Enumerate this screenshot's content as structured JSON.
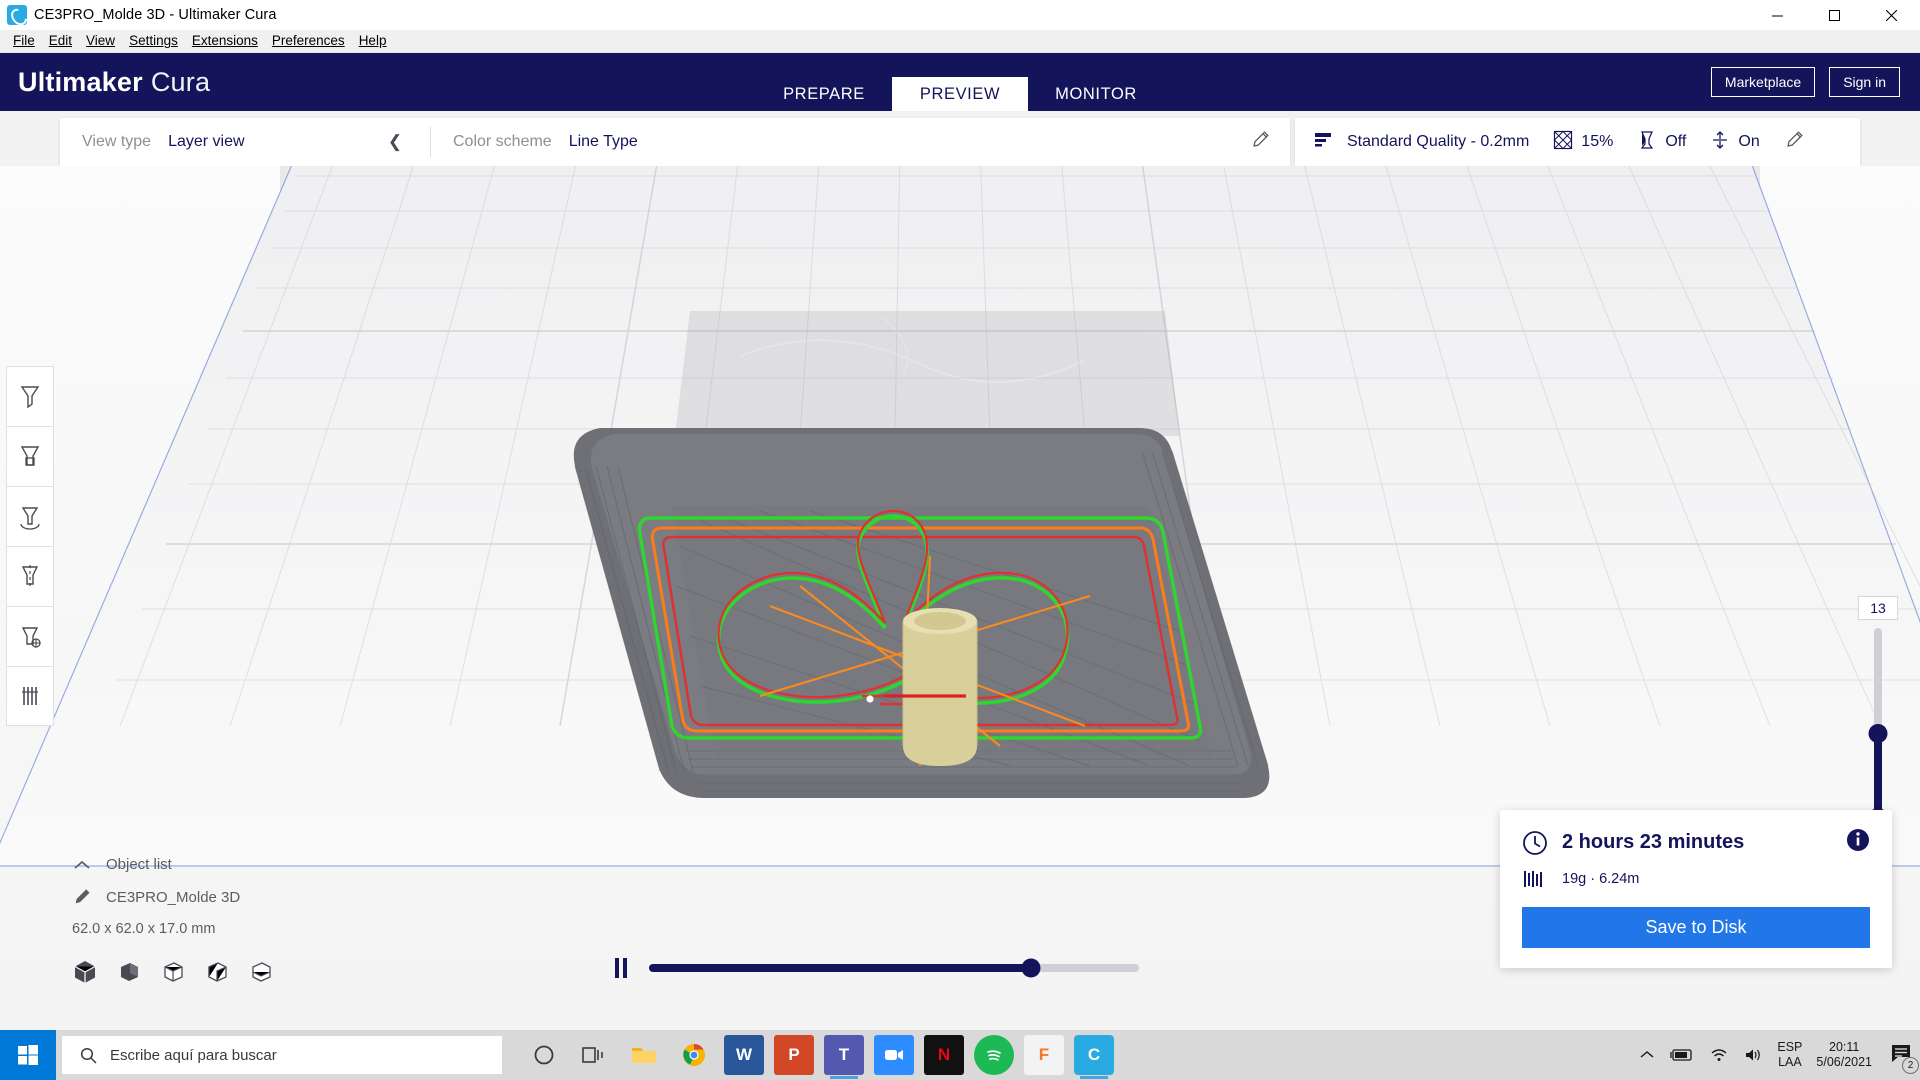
{
  "window": {
    "title": "CE3PRO_Molde 3D - Ultimaker Cura",
    "app_icon": "cura-icon",
    "minimize_label": "Minimize",
    "maximize_label": "Maximize",
    "close_label": "Close"
  },
  "menubar": {
    "items": [
      {
        "label": "File",
        "accel": "F"
      },
      {
        "label": "Edit",
        "accel": "E"
      },
      {
        "label": "View",
        "accel": "V"
      },
      {
        "label": "Settings",
        "accel": "S"
      },
      {
        "label": "Extensions",
        "accel": "x"
      },
      {
        "label": "Preferences",
        "accel": "r"
      },
      {
        "label": "Help",
        "accel": "H"
      }
    ]
  },
  "header": {
    "brand_bold": "Ultimaker",
    "brand_light": "Cura",
    "tabs": [
      {
        "label": "PREPARE",
        "active": false
      },
      {
        "label": "PREVIEW",
        "active": true
      },
      {
        "label": "MONITOR",
        "active": false
      }
    ],
    "marketplace_label": "Marketplace",
    "signin_label": "Sign in",
    "accent_color": "#14145a"
  },
  "viewbar": {
    "view_type_label": "View type",
    "view_type_value": "Layer view",
    "collapse_icon": "chevron-left-icon",
    "color_scheme_label": "Color scheme",
    "color_scheme_value": "Line Type",
    "edit_icon": "pencil-icon",
    "profile_icon": "quality-bars-icon",
    "profile_value": "Standard Quality - 0.2mm",
    "infill_icon": "infill-icon",
    "infill_value": "15%",
    "support_icon": "support-icon",
    "support_value": "Off",
    "adhesion_icon": "adhesion-icon",
    "adhesion_value": "On",
    "settings_edit_icon": "pencil-icon"
  },
  "tools": [
    {
      "name": "move-tool",
      "icon": "move-icon"
    },
    {
      "name": "scale-tool",
      "icon": "scale-icon"
    },
    {
      "name": "rotate-tool",
      "icon": "rotate-icon"
    },
    {
      "name": "mirror-tool",
      "icon": "mirror-icon"
    },
    {
      "name": "per-model-settings-tool",
      "icon": "per-model-icon"
    },
    {
      "name": "support-blocker-tool",
      "icon": "support-blocker-icon"
    }
  ],
  "object_list": {
    "toggle_icon": "chevron-up-icon",
    "title": "Object list",
    "item_icon": "pencil-icon",
    "item_name": "CE3PRO_Molde 3D",
    "dimensions": "62.0 x 62.0 x 17.0 mm",
    "view_icons": [
      "solid-cube-icon",
      "half-shaded-cube-icon",
      "wire-cube-icon",
      "xray-cube-icon",
      "layer-cube-icon"
    ]
  },
  "playback": {
    "pause_icon": "pause-icon",
    "progress_percent": 78
  },
  "layer_slider": {
    "current_layer": "13",
    "fill_percent": 45
  },
  "print_info": {
    "clock_icon": "clock-icon",
    "time_estimate": "2 hours 23 minutes",
    "info_icon": "info-icon",
    "material_icon": "filament-icon",
    "material_estimate": "19g · 6.24m",
    "save_label": "Save to Disk",
    "save_color": "#2176e8"
  },
  "taskbar": {
    "start_icon": "windows-logo-icon",
    "search_icon": "search-icon",
    "search_placeholder": "Escribe aquí para buscar",
    "apps": [
      {
        "name": "cortana-icon",
        "glyph": "",
        "color": "#3a3a3a"
      },
      {
        "name": "task-view-icon",
        "glyph": "",
        "color": "#3a3a3a"
      },
      {
        "name": "file-explorer-icon",
        "glyph": "",
        "color": "#f3b21b"
      },
      {
        "name": "chrome-icon",
        "glyph": "",
        "color": "#ffffff"
      },
      {
        "name": "word-icon",
        "glyph": "W",
        "color": "#2b579a"
      },
      {
        "name": "powerpoint-icon",
        "glyph": "P",
        "color": "#d24726"
      },
      {
        "name": "teams-icon",
        "glyph": "T",
        "color": "#5558af"
      },
      {
        "name": "zoom-icon",
        "glyph": "",
        "color": "#2d8cff"
      },
      {
        "name": "netflix-icon",
        "glyph": "N",
        "color": "#e50914"
      },
      {
        "name": "spotify-icon",
        "glyph": "",
        "color": "#1db954"
      },
      {
        "name": "fusion360-icon",
        "glyph": "F",
        "color": "#f3762b"
      },
      {
        "name": "cura-taskbar-icon",
        "glyph": "C",
        "color": "#29abe2"
      }
    ],
    "tray": {
      "chevron_icon": "chevron-up-icon",
      "battery_icon": "battery-charging-icon",
      "wifi_icon": "wifi-icon",
      "volume_icon": "volume-icon",
      "language_top": "ESP",
      "language_bottom": "LAA",
      "time": "20:11",
      "date": "5/06/2021",
      "notification_icon": "notification-icon",
      "notification_count": "2"
    }
  }
}
